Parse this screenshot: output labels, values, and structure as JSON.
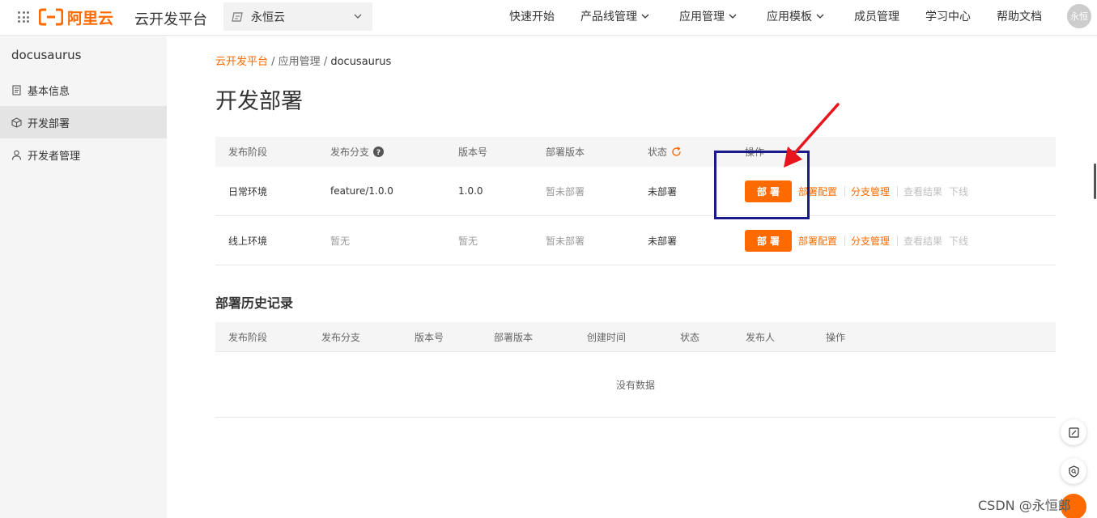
{
  "header": {
    "logo_text": "阿里云",
    "platform_title": "云开发平台",
    "space_selector": "永恒云",
    "nav": [
      {
        "label": "快速开始"
      },
      {
        "label": "产品线管理"
      },
      {
        "label": "应用管理"
      },
      {
        "label": "应用模板"
      },
      {
        "label": "成员管理"
      },
      {
        "label": "学习中心"
      },
      {
        "label": "帮助文档"
      }
    ],
    "avatar": "永恒",
    "brand_color": "#ff6a00"
  },
  "sidebar": {
    "app_name": "docusaurus",
    "items": [
      {
        "label": "基本信息",
        "icon": "document-icon"
      },
      {
        "label": "开发部署",
        "icon": "cube-icon",
        "active": true
      },
      {
        "label": "开发者管理",
        "icon": "user-icon"
      }
    ]
  },
  "breadcrumb": {
    "root": "云开发平台",
    "sep1": " / ",
    "mid": "应用管理",
    "sep2": " / ",
    "current": "docusaurus"
  },
  "page_title": "开发部署",
  "deploy_table": {
    "columns": [
      "发布阶段",
      "发布分支",
      "版本号",
      "部署版本",
      "状态",
      "操作"
    ],
    "rows": [
      {
        "stage": "日常环境",
        "branch": "feature/1.0.0",
        "version": "1.0.0",
        "deploy_version": "暂未部署",
        "status": "未部署"
      },
      {
        "stage": "线上环境",
        "branch": "暂无",
        "version": "暂无",
        "deploy_version": "暂未部署",
        "status": "未部署"
      }
    ],
    "actions": {
      "deploy": "部署",
      "config": "部署配置",
      "branch_mgmt": "分支管理",
      "view_result": "查看结果",
      "offline": "下线"
    }
  },
  "history": {
    "title": "部署历史记录",
    "columns": [
      "发布阶段",
      "发布分支",
      "版本号",
      "部署版本",
      "创建时间",
      "状态",
      "发布人",
      "操作"
    ],
    "empty_text": "没有数据"
  },
  "watermark": "CSDN @永恒郎",
  "annotation_colors": {
    "box": "#1a1a8a",
    "arrow": "#e8141e"
  }
}
